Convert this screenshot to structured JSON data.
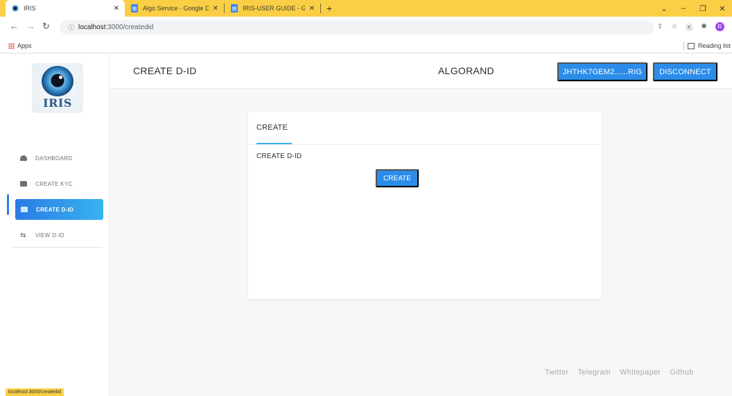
{
  "browser": {
    "tabs": [
      {
        "title": "IRIS",
        "active": true
      },
      {
        "title": "Algo Service - Google Docs",
        "active": false
      },
      {
        "title": "IRIS-USER GUIDE - Google Docs",
        "active": false
      }
    ],
    "url_host": "localhost",
    "url_path": ":3000/createdid",
    "bookmarks_apps": "Apps",
    "reading_list": "Reading list",
    "profile_initial": "R",
    "status_url": "localhost:3000/createdid",
    "accent_color": "#fbcf45"
  },
  "sidebar": {
    "logo_text": "IRIS",
    "items": [
      {
        "label": "DASHBOARD",
        "icon": "dashboard-icon",
        "active": false
      },
      {
        "label": "CREATE KYC",
        "icon": "card-icon",
        "active": false
      },
      {
        "label": "CREATE D-ID",
        "icon": "card-icon",
        "active": true
      },
      {
        "label": "VIEW D-ID",
        "icon": "repeat-icon",
        "active": false
      }
    ]
  },
  "header": {
    "title": "CREATE D-ID",
    "network": "ALGORAND",
    "address_button": "JHTHK7GEM2......RIG",
    "disconnect_button": "DISCONNECT",
    "button_color": "#2b8de9"
  },
  "card": {
    "tab_label": "CREATE",
    "field_label": "CREATE D-ID",
    "create_button": "CREATE"
  },
  "footer": {
    "links": [
      "Twitter",
      "Telegram",
      "Whitepaper",
      "Github"
    ]
  }
}
